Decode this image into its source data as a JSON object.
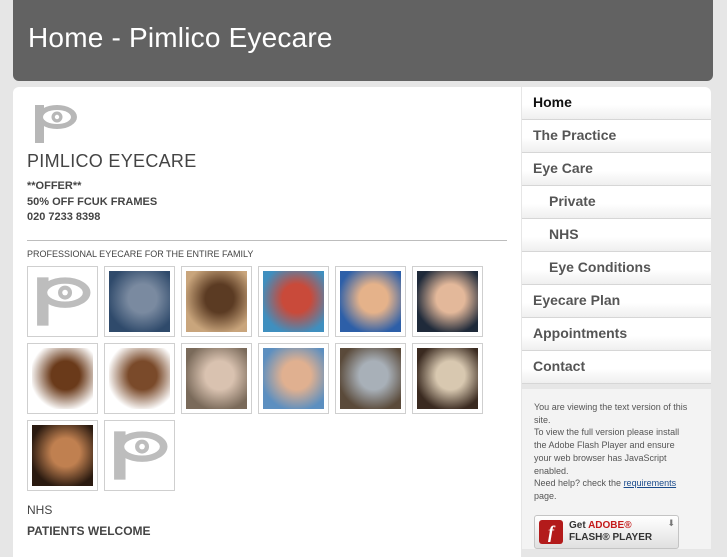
{
  "header": {
    "title": "Home - Pimlico Eyecare"
  },
  "brand": {
    "company": "PIMLICO EYECARE",
    "logo_icon": "eye-p-logo-icon"
  },
  "offer": {
    "line1": "**OFFER**",
    "line2": "50% OFF FCUK FRAMES",
    "phone": "020 7233 8398"
  },
  "tagline": "PROFESSIONAL EYECARE FOR THE ENTIRE FAMILY",
  "gallery": [
    {
      "kind": "logo"
    },
    {
      "kind": "photo",
      "colors": [
        "#2f4a6b",
        "#7a8aa0"
      ]
    },
    {
      "kind": "photo",
      "colors": [
        "#c9a57c",
        "#5b3b23"
      ]
    },
    {
      "kind": "photo",
      "colors": [
        "#3f8fbf",
        "#c94a3a"
      ]
    },
    {
      "kind": "photo",
      "colors": [
        "#2d5fa8",
        "#e5b28a"
      ]
    },
    {
      "kind": "photo",
      "colors": [
        "#1f2a3a",
        "#e3b89a"
      ]
    },
    {
      "kind": "photo",
      "colors": [
        "#ffffff",
        "#6a3a1a"
      ]
    },
    {
      "kind": "photo",
      "colors": [
        "#ffffff",
        "#7a4a2a"
      ]
    },
    {
      "kind": "photo",
      "colors": [
        "#7a6a5a",
        "#d9c2b0"
      ]
    },
    {
      "kind": "photo",
      "colors": [
        "#5c8fc0",
        "#e0b090"
      ]
    },
    {
      "kind": "photo",
      "colors": [
        "#5a4a3a",
        "#a8b0b8"
      ]
    },
    {
      "kind": "photo",
      "colors": [
        "#3a2a20",
        "#d8c8b0"
      ]
    },
    {
      "kind": "photo",
      "colors": [
        "#2a1a10",
        "#c08050"
      ]
    },
    {
      "kind": "logo"
    }
  ],
  "nhs": "NHS",
  "patients": "PATIENTS WELCOME",
  "nav": [
    {
      "label": "Home",
      "sub": false,
      "active": true
    },
    {
      "label": "The Practice",
      "sub": false
    },
    {
      "label": "Eye Care",
      "sub": false
    },
    {
      "label": "Private",
      "sub": true
    },
    {
      "label": "NHS",
      "sub": true
    },
    {
      "label": "Eye Conditions",
      "sub": true
    },
    {
      "label": "Eyecare Plan",
      "sub": false
    },
    {
      "label": "Appointments",
      "sub": false
    },
    {
      "label": "Contact",
      "sub": false
    }
  ],
  "flash_note": {
    "line1": "You are viewing the text version of this site.",
    "line2": "To view the full version please install the Adobe Flash Player and ensure your web browser has JavaScript enabled.",
    "help_prefix": "Need help? check the ",
    "help_link": "requirements",
    "help_suffix": " page."
  },
  "flash_badge": {
    "get": "Get ",
    "adobe": "ADOBE",
    "reg": "®",
    "player": "FLASH® PLAYER",
    "icon": "flash-f-icon"
  }
}
